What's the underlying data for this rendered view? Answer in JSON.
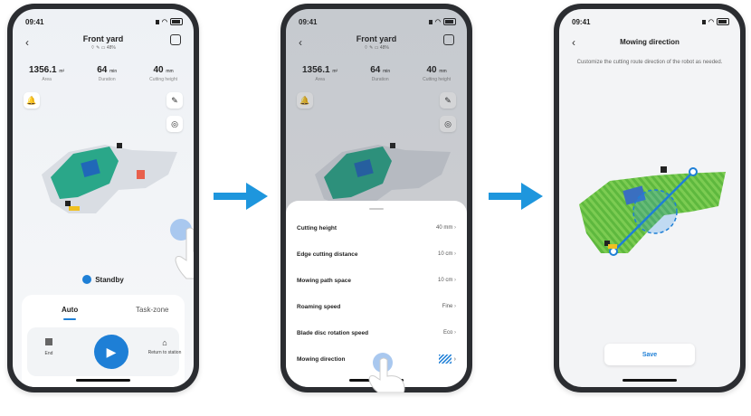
{
  "status": {
    "time": "09:41"
  },
  "screen1": {
    "title": "Front yard",
    "subtitle": "48%",
    "stats": [
      {
        "value": "1356.1",
        "unit": "m²",
        "label": "Area"
      },
      {
        "value": "64",
        "unit": "min",
        "label": "Duration"
      },
      {
        "value": "40",
        "unit": "mm",
        "label": "Cutting height"
      }
    ],
    "robot_status": "Standby",
    "tabs": {
      "auto": "Auto",
      "task_zone": "Task-zone"
    },
    "controls": {
      "end": "End",
      "return": "Return to station"
    }
  },
  "screen2": {
    "title": "Front yard",
    "subtitle": "48%",
    "stats": [
      {
        "value": "1356.1",
        "unit": "m²",
        "label": "Area"
      },
      {
        "value": "64",
        "unit": "min",
        "label": "Duration"
      },
      {
        "value": "40",
        "unit": "mm",
        "label": "Cutting height"
      }
    ],
    "settings": [
      {
        "label": "Cutting height",
        "value": "40 mm"
      },
      {
        "label": "Edge cutting distance",
        "value": "10 cm"
      },
      {
        "label": "Mowing path space",
        "value": "10 cm"
      },
      {
        "label": "Roaming speed",
        "value": "Fine"
      },
      {
        "label": "Blade disc rotation speed",
        "value": "Eco"
      },
      {
        "label": "Mowing direction",
        "value": ""
      }
    ]
  },
  "screen3": {
    "title": "Mowing direction",
    "description": "Customize the cutting route direction of the robot as needed.",
    "save": "Save"
  },
  "colors": {
    "accent": "#1e7fd6",
    "lawn_teal": "#2aa789",
    "lawn_green": "#6cc04a",
    "arrow": "#1e96dd"
  }
}
